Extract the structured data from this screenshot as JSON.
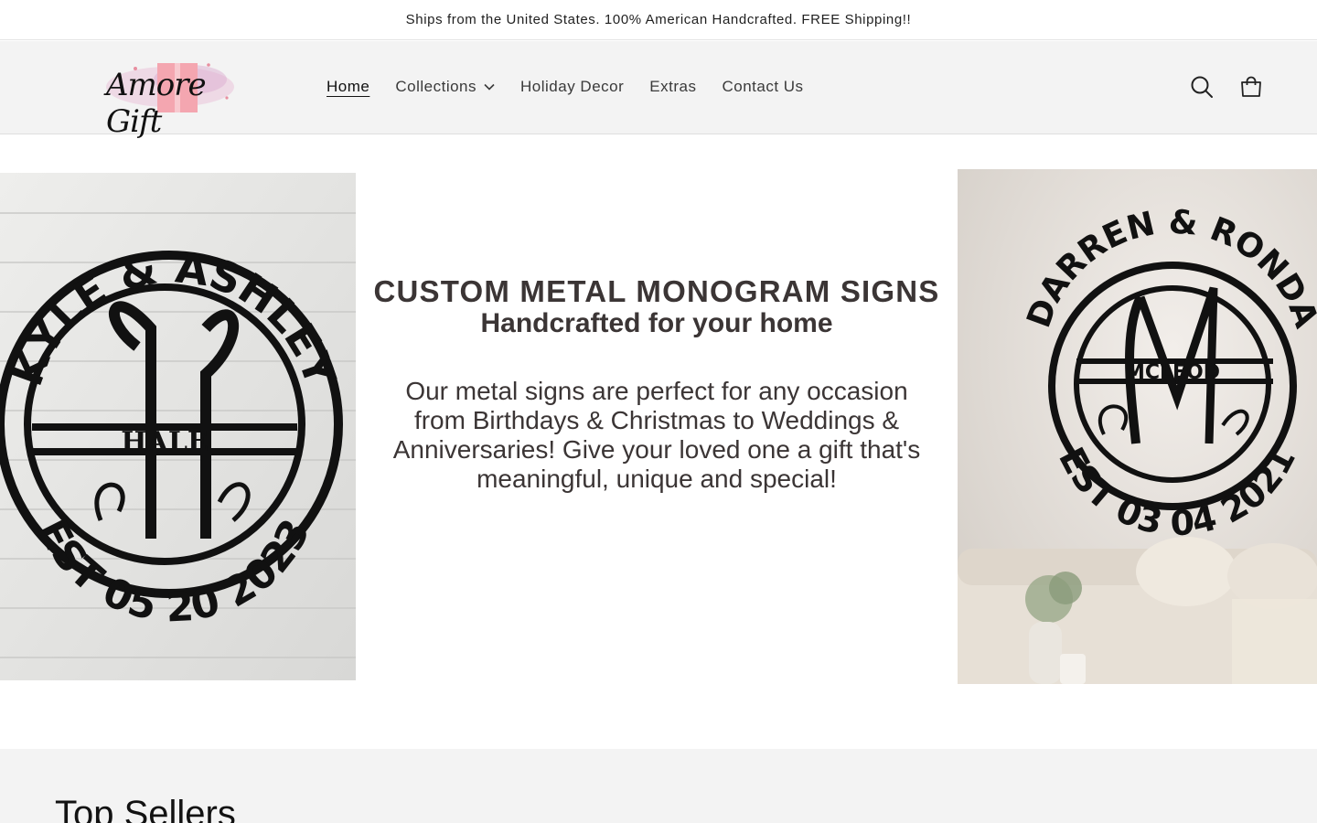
{
  "announcement": {
    "text": "Ships from the United States. 100% American Handcrafted. FREE Shipping!!"
  },
  "header": {
    "logo_text": "Amore Gift",
    "nav": [
      {
        "label": "Home",
        "active": true
      },
      {
        "label": "Collections",
        "has_dropdown": true
      },
      {
        "label": "Holiday Decor"
      },
      {
        "label": "Extras"
      },
      {
        "label": "Contact Us"
      }
    ],
    "icons": {
      "search": "search-icon",
      "cart": "cart-icon"
    }
  },
  "hero": {
    "title": "CUSTOM METAL MONOGRAM SIGNS",
    "subtitle": "Handcrafted for your home",
    "body": "Our metal signs are perfect for any occasion from Birthdays & Christmas to Weddings & Anniversaries! Give your loved one a gift that's meaningful, unique and special!",
    "left_sign": {
      "top": "KYLE & ASHLEY",
      "letter": "H",
      "name": "HALE",
      "bottom": "EST 05 20 2023"
    },
    "right_sign": {
      "top": "DARREN & RONDA",
      "letter": "M",
      "name": "MCLEOD",
      "bottom": "EST 03 04 2021"
    }
  },
  "sections": {
    "top_sellers_title": "Top Sellers"
  },
  "colors": {
    "header_bg": "#f3f3f3",
    "hero_text": "#3b3535",
    "logo_pink": "#f4a6b0",
    "sign_black": "#111111"
  }
}
